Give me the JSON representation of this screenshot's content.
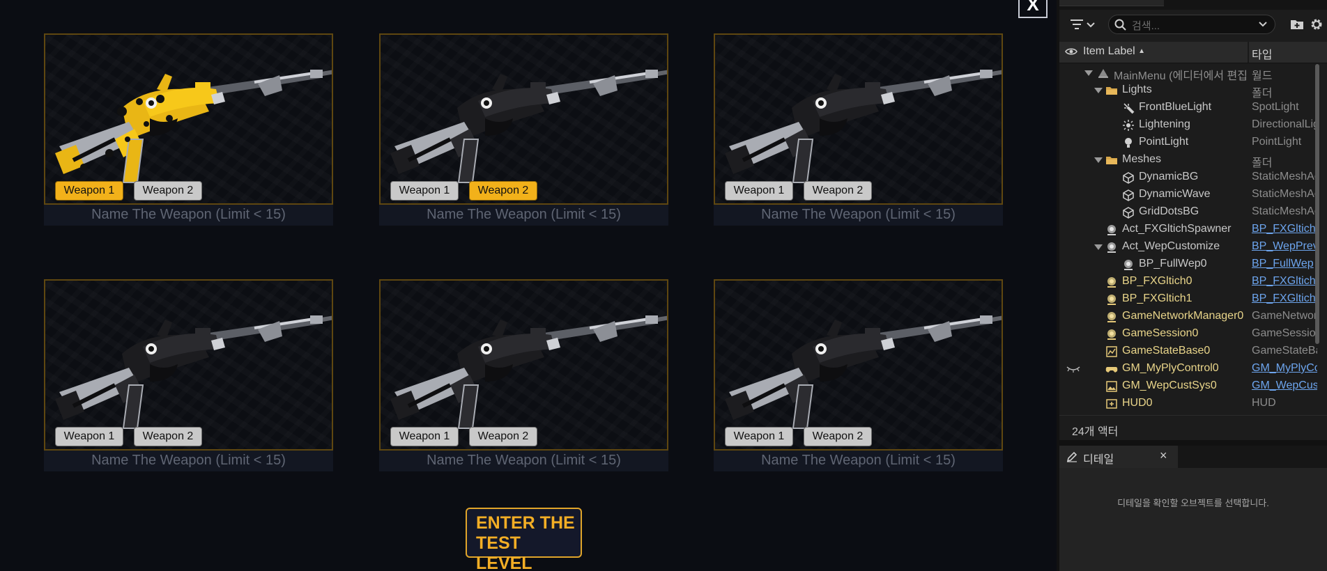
{
  "viewport": {
    "close_label": "X",
    "enter_button": [
      "ENTER THE",
      "TEST LEVEL"
    ],
    "cards": [
      {
        "weapon1": "Weapon 1",
        "weapon2": "Weapon 2",
        "selected": 1,
        "placeholder": "Name The Weapon (Limit < 15)"
      },
      {
        "weapon1": "Weapon 1",
        "weapon2": "Weapon 2",
        "selected": 2,
        "placeholder": "Name The Weapon (Limit < 15)"
      },
      {
        "weapon1": "Weapon 1",
        "weapon2": "Weapon 2",
        "selected": 0,
        "placeholder": "Name The Weapon (Limit < 15)"
      },
      {
        "weapon1": "Weapon 1",
        "weapon2": "Weapon 2",
        "selected": 0,
        "placeholder": "Name The Weapon (Limit < 15)"
      },
      {
        "weapon1": "Weapon 1",
        "weapon2": "Weapon 2",
        "selected": 0,
        "placeholder": "Name The Weapon (Limit < 15)"
      },
      {
        "weapon1": "Weapon 1",
        "weapon2": "Weapon 2",
        "selected": 0,
        "placeholder": "Name The Weapon (Limit < 15)"
      }
    ]
  },
  "outliner": {
    "search_placeholder": "검색...",
    "col_label": "Item Label",
    "col_type": "타입",
    "rows": [
      {
        "label": "MainMenu (에디터에서 편집)",
        "type": "월드",
        "icon": "world-icon",
        "arrow": true
      },
      {
        "label": "Lights",
        "type": "폴더",
        "icon": "folder-icon",
        "arrow": true
      },
      {
        "label": "FrontBlueLight",
        "type": "SpotLight",
        "icon": "spotlight-icon"
      },
      {
        "label": "Lightening",
        "type": "DirectionalLight",
        "icon": "sun-icon"
      },
      {
        "label": "PointLight",
        "type": "PointLight",
        "icon": "bulb-icon"
      },
      {
        "label": "Meshes",
        "type": "폴더",
        "icon": "folder-icon",
        "arrow": true
      },
      {
        "label": "DynamicBG",
        "type": "StaticMeshActor",
        "icon": "cube-icon"
      },
      {
        "label": "DynamicWave",
        "type": "StaticMeshActor",
        "icon": "cube-icon"
      },
      {
        "label": "GridDotsBG",
        "type": "StaticMeshActor",
        "icon": "cube-icon"
      },
      {
        "label": "Act_FXGltichSpawner",
        "type": "BP_FXGltichSpawner",
        "icon": "actor-icon",
        "link": true
      },
      {
        "label": "Act_WepCustomize",
        "type": "BP_WepPreview",
        "icon": "actor-icon",
        "link": true,
        "arrow": true
      },
      {
        "label": "BP_FullWep0",
        "type": "BP_FullWep",
        "icon": "actor-icon",
        "link": true
      },
      {
        "label": "BP_FXGltich0",
        "type": "BP_FXGltich",
        "icon": "actor-icon",
        "link": true,
        "yellow": true
      },
      {
        "label": "BP_FXGltich1",
        "type": "BP_FXGltich",
        "icon": "actor-icon",
        "link": true,
        "yellow": true
      },
      {
        "label": "GameNetworkManager0",
        "type": "GameNetworkManager",
        "icon": "actor-icon",
        "yellow": true
      },
      {
        "label": "GameSession0",
        "type": "GameSession",
        "icon": "actor-icon",
        "yellow": true
      },
      {
        "label": "GameStateBase0",
        "type": "GameStateBase",
        "icon": "chart-icon",
        "yellow": true
      },
      {
        "label": "GM_MyPlyControl0",
        "type": "GM_MyPlyControl",
        "icon": "gamepad-icon",
        "link": true,
        "yellow": true,
        "hidden_eye": true
      },
      {
        "label": "GM_WepCustSys0",
        "type": "GM_WepCustSys",
        "icon": "image-icon",
        "link": true,
        "yellow": true
      },
      {
        "label": "HUD0",
        "type": "HUD",
        "icon": "hud-icon",
        "yellow": true
      }
    ],
    "actor_count": "24개 액터"
  },
  "details": {
    "tab_title": "디테일",
    "close_label": "×",
    "empty_message": "디테일을 확인할 오브젝트를 선택합니다."
  },
  "colors": {
    "accent": "#f2b11a",
    "card_border": "#5f4710",
    "link": "#6da5ee"
  }
}
